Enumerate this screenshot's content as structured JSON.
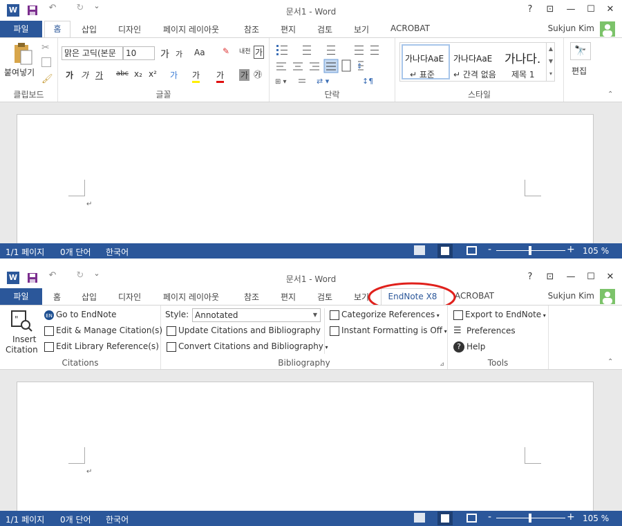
{
  "app": {
    "title": "문서1 - Word",
    "user": "Sukjun Kim"
  },
  "qat": {
    "undo": "↶",
    "redo": "↻",
    "more": "⌄"
  },
  "window_controls": {
    "help": "?",
    "ribbon_opts": "⊡",
    "minimize": "—",
    "maximize": "☐",
    "close": "✕"
  },
  "tabs1": [
    "파일",
    "홈",
    "삽입",
    "디자인",
    "페이지 레이아웃",
    "참조",
    "편지",
    "검토",
    "보기",
    "ACROBAT"
  ],
  "tabs2": [
    "파일",
    "홈",
    "삽입",
    "디자인",
    "페이지 레이아웃",
    "참조",
    "편지",
    "검토",
    "보기",
    "EndNote X8",
    "ACROBAT"
  ],
  "home": {
    "clipboard": {
      "paste": "붙여넣기",
      "label": "클립보드"
    },
    "font": {
      "name": "맑은 고딕(본문",
      "size": "10",
      "label": "글꼴",
      "grow": "가",
      "shrink": "가",
      "case": "Aa",
      "bold": "가",
      "italic": "가",
      "underline": "가",
      "strike": "abc",
      "sub": "x₂",
      "sup": "x²",
      "effects": "가",
      "highlight": "가",
      "color": "가",
      "shade": "가",
      "enclose": "㉮",
      "phonetic": "내천",
      "border": "가"
    },
    "paragraph": {
      "label": "단락"
    },
    "styles": {
      "label": "스타일",
      "items": [
        {
          "preview": "가나다AaE",
          "name": "↵ 표준"
        },
        {
          "preview": "가나다AaE",
          "name": "↵ 간격 없음"
        },
        {
          "preview": "가나다.",
          "name": "제목 1"
        }
      ]
    },
    "editing": {
      "label": "편집"
    }
  },
  "endnote": {
    "citations": {
      "insert": "Insert",
      "citation": "Citation",
      "goto": "Go to EndNote",
      "edit_manage": "Edit & Manage Citation(s)",
      "edit_library": "Edit Library Reference(s)",
      "label": "Citations"
    },
    "bibliography": {
      "style_label": "Style:",
      "style_value": "Annotated",
      "update": "Update Citations and Bibliography",
      "convert": "Convert Citations and Bibliography",
      "categorize": "Categorize References",
      "instant": "Instant Formatting is Off",
      "label": "Bibliography"
    },
    "tools": {
      "export": "Export to EndNote",
      "preferences": "Preferences",
      "help": "Help",
      "label": "Tools"
    }
  },
  "status": {
    "page": "1/1 페이지",
    "words": "0개 단어",
    "lang": "한국어",
    "zoom": "105 %",
    "minus": "-",
    "plus": "+"
  },
  "doc": {
    "para_mark": "↵"
  },
  "colors": {
    "brand": "#2b579a",
    "highlight_circle": "#e0201b"
  }
}
